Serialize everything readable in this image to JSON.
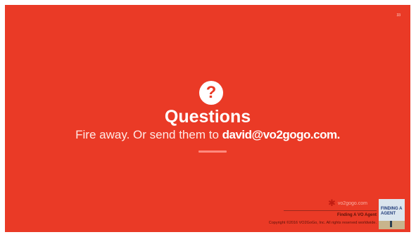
{
  "slide": {
    "number": "33",
    "icon": "question-circle-icon",
    "title": "Questions",
    "subtitle_text": "Fire away. Or send them to ",
    "subtitle_email": "david@vo2gogo.com.",
    "brand": "vo2gogo.com",
    "footer_title": "Finding A VO Agent",
    "copyright": "Copyright ©2016 VO2GoGo, Inc. All rights reserved worldwide.",
    "thumbnail_line1": "FINDING A",
    "thumbnail_line2": "AGENT"
  },
  "colors": {
    "background": "#ea3a26",
    "text": "#ffffff",
    "accent": "#ff8a7d"
  }
}
